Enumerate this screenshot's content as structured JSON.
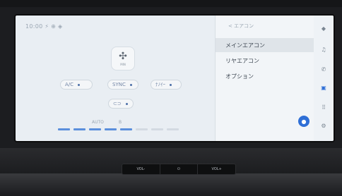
{
  "status_bar": {
    "text": "10:00 ⚡ ⊕ ◈"
  },
  "fan": {
    "icon": "fan-icon",
    "label": "MIN"
  },
  "controls": {
    "ac_label": "A/C",
    "sync_label": "SYNC",
    "nano_label": "ﾅﾉｲｰ",
    "recirc_label": "⊂⊃"
  },
  "fan_level": {
    "auto_label": "AUTO",
    "speed_label": "B",
    "active_bars": 5,
    "total_bars": 8
  },
  "panel": {
    "header": "< エアコン",
    "items": [
      {
        "label": "メインエアコン",
        "selected": true
      },
      {
        "label": "リヤエアコン",
        "selected": false
      },
      {
        "label": "オプション",
        "selected": false
      }
    ]
  },
  "rail": {
    "icons": [
      "home-icon",
      "music-icon",
      "phone-icon",
      "car-icon",
      "apps-icon",
      "settings-icon"
    ]
  },
  "assistant": {
    "icon": "mic-icon"
  },
  "hardware_buttons": [
    {
      "label": "VOL-"
    },
    {
      "label": "⏻"
    },
    {
      "label": "VOL+"
    }
  ],
  "colors": {
    "accent": "#2f6fd6",
    "level_active": "#5b8fdc",
    "level_inactive": "#d3dae2"
  }
}
